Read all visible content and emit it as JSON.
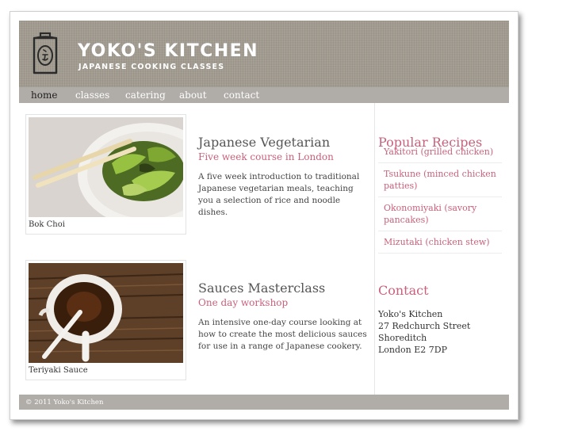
{
  "brand": {
    "title": "YOKO'S KITCHEN",
    "subtitle": "JAPANESE COOKING CLASSES",
    "logo": "tea-canister-logo-icon"
  },
  "nav": {
    "items": [
      {
        "label": "home",
        "active": true
      },
      {
        "label": "classes",
        "active": false
      },
      {
        "label": "catering",
        "active": false
      },
      {
        "label": "about",
        "active": false
      },
      {
        "label": "contact",
        "active": false
      }
    ]
  },
  "courses": [
    {
      "image_caption": "Bok Choi",
      "title": "Japanese Vegetarian",
      "subtitle": "Five week course in London",
      "description": "A five week introduction to traditional Japanese vegetarian meals, teaching you a selection of rice and noodle dishes."
    },
    {
      "image_caption": "Teriyaki Sauce",
      "title": "Sauces Masterclass",
      "subtitle": "One day workshop",
      "description": "An intensive one-day course looking at how to create the most delicious sauces for use in a range of Japanese cookery."
    }
  ],
  "sidebar": {
    "recipes_heading": "Popular Recipes",
    "recipes": [
      "Yakitori (grilled chicken)",
      "Tsukune (minced chicken patties)",
      "Okonomiyaki (savory pancakes)",
      "Mizutaki (chicken stew)"
    ],
    "contact_heading": "Contact",
    "address": [
      "Yoko's Kitchen",
      "27 Redchurch Street",
      "Shoreditch",
      "London E2 7DP"
    ]
  },
  "footer": {
    "text": "© 2011 Yoko's Kitchen"
  },
  "colors": {
    "accent": "#c9617c",
    "header_bg": "#a19b90",
    "nav_bg": "#b0aca8"
  }
}
